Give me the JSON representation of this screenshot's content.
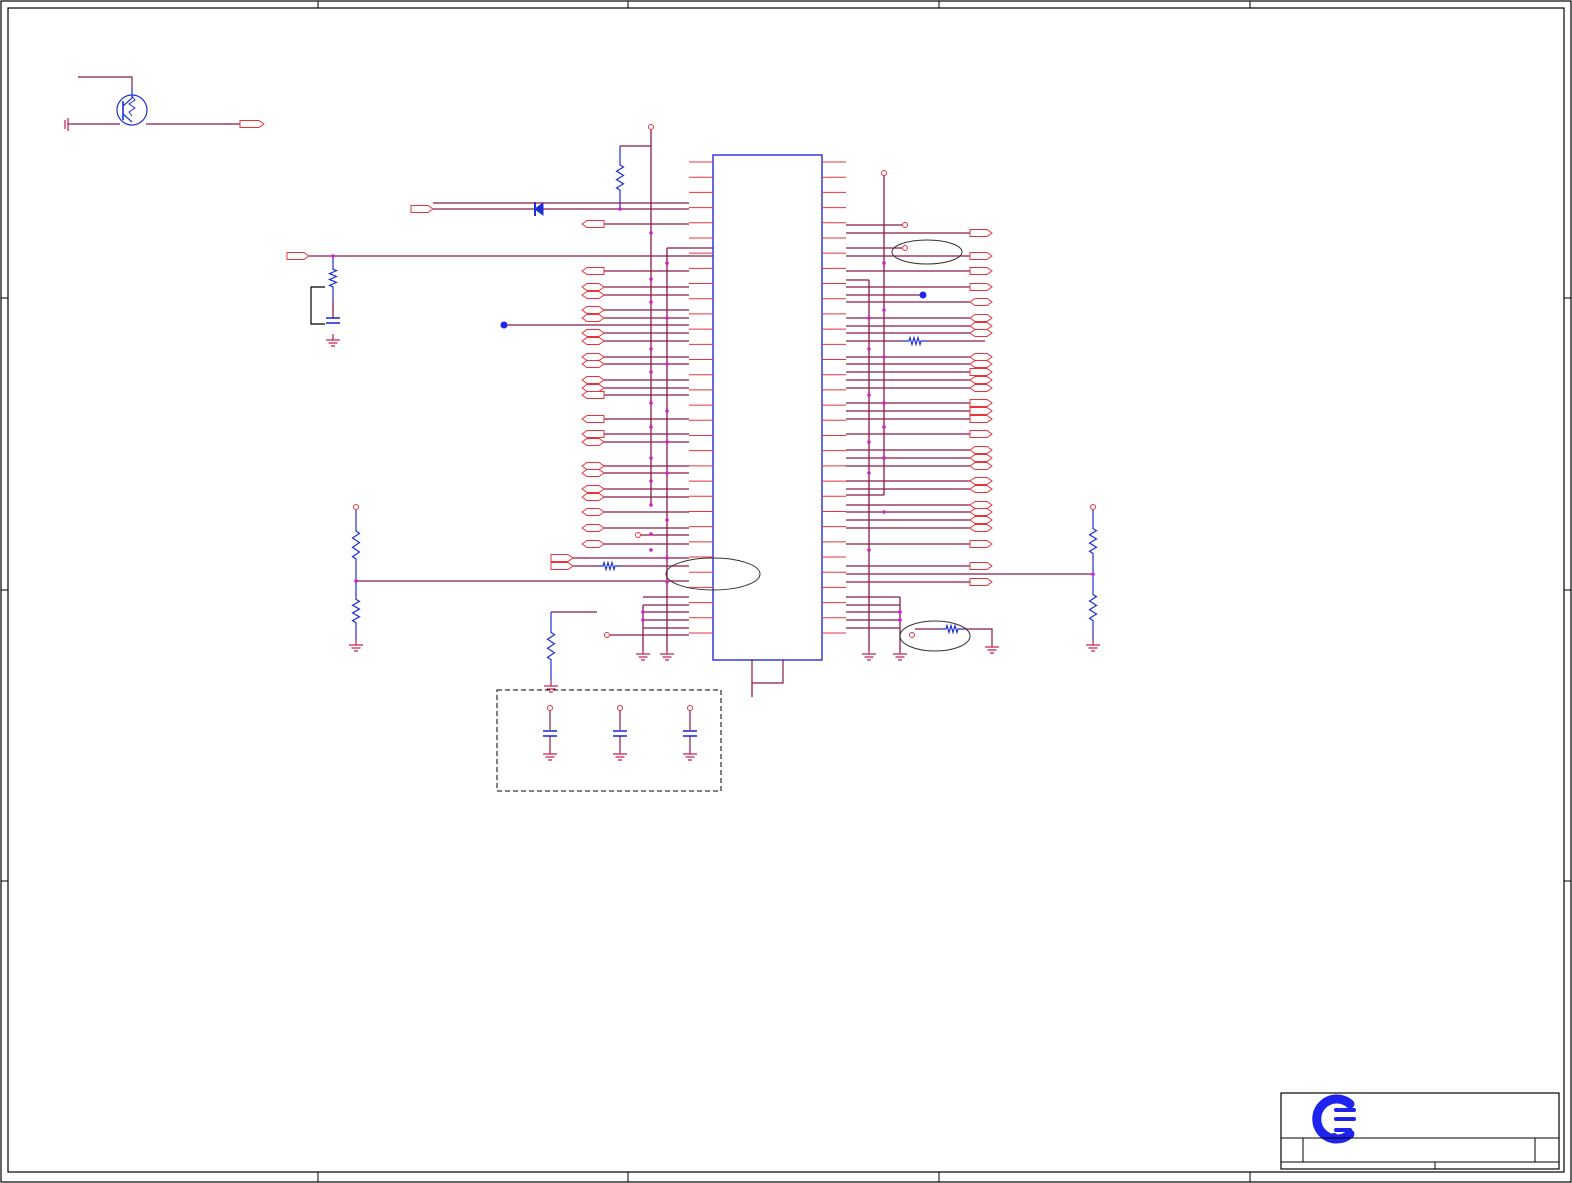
{
  "colors": {
    "wire": "#8b1a4a",
    "pin": "#e8323c",
    "component": "#1f2fd6",
    "junction": "#d020d0",
    "frame": "#000000",
    "ground": "#c01848",
    "logo": "#1e24ee"
  },
  "icons": {
    "logo": "company-logo-icon",
    "transistor": "npn-transistor-icon",
    "diode": "diode-icon",
    "ground": "ground-icon"
  },
  "ic": {
    "left_pin_count": 32,
    "right_pin_count": 32
  },
  "title_block": {
    "company": "",
    "title": "",
    "size": "",
    "doc_number": "",
    "rev": "",
    "date": "",
    "sheet": ""
  }
}
